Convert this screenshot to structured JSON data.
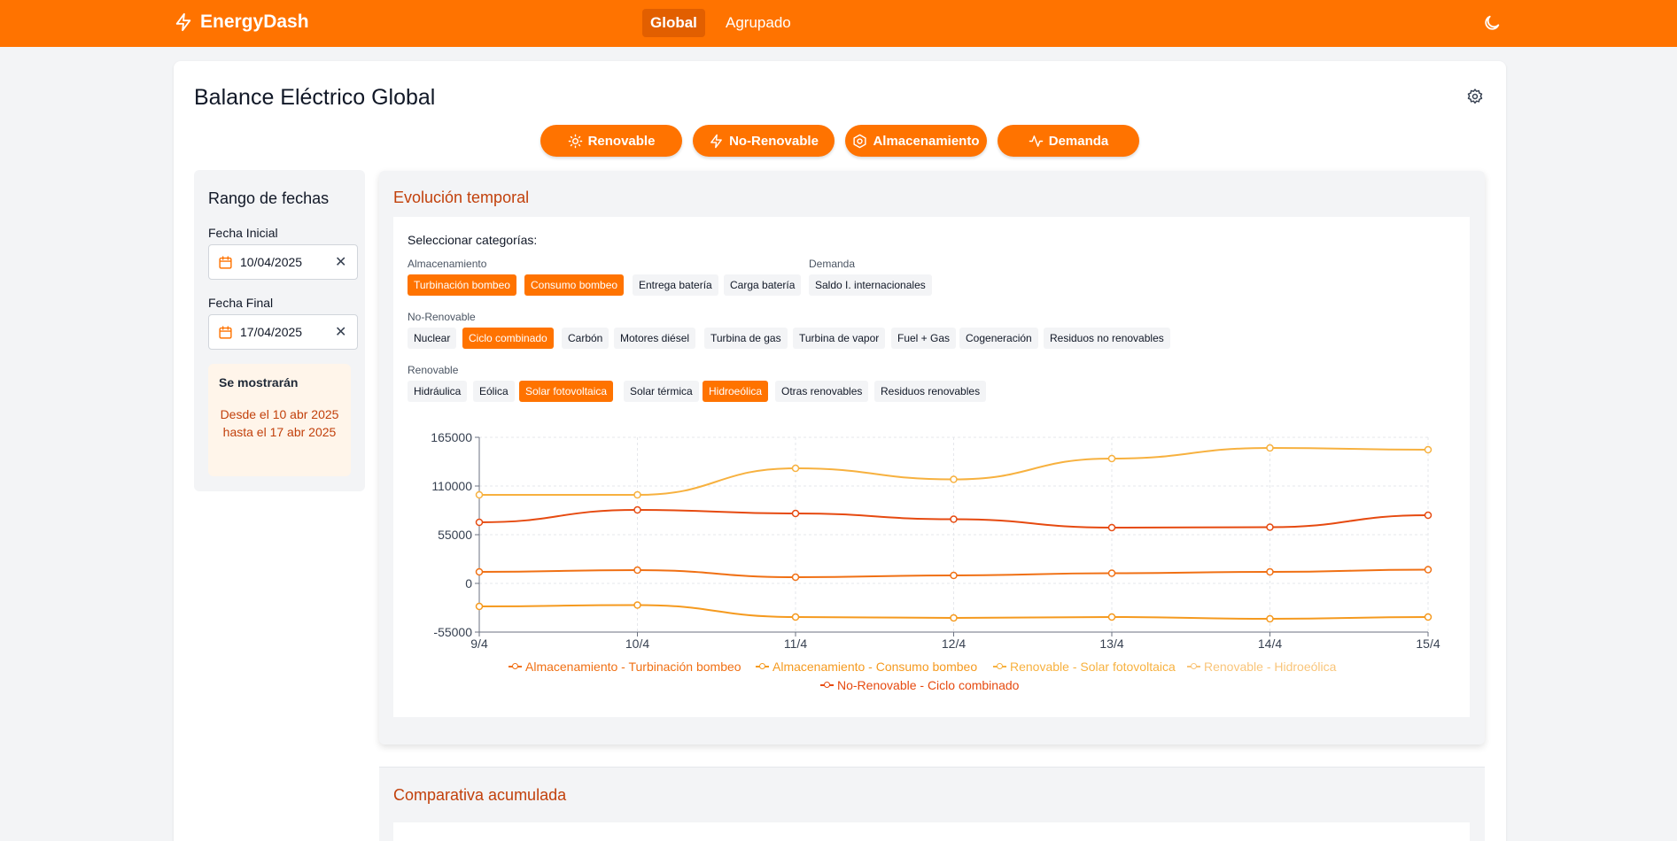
{
  "app": {
    "brand": "EnergyDash",
    "nav": [
      {
        "label": "Global",
        "active": true
      },
      {
        "label": "Agrupado",
        "active": false
      }
    ]
  },
  "page": {
    "title": "Balance Eléctrico Global",
    "categories": [
      {
        "label": "Renovable",
        "icon": "sun-icon"
      },
      {
        "label": "No-Renovable",
        "icon": "lightning-icon"
      },
      {
        "label": "Almacenamiento",
        "icon": "hexagon-icon"
      },
      {
        "label": "Demanda",
        "icon": "activity-icon"
      }
    ]
  },
  "sidebar": {
    "title": "Rango de fechas",
    "start_label": "Fecha Inicial",
    "start_value": "10/04/2025",
    "end_label": "Fecha Final",
    "end_value": "17/04/2025",
    "clear_symbol": "✕",
    "info_title": "Se mostrarán",
    "info_text": "Desde el 10 abr 2025 hasta el 17 abr 2025"
  },
  "panel": {
    "title": "Evolución temporal",
    "select_label": "Seleccionar categorías:",
    "groups": {
      "almacenamiento": {
        "label": "Almacenamiento",
        "chips": [
          {
            "label": "Turbinación bombeo",
            "selected": true
          },
          {
            "label": "Consumo bombeo",
            "selected": true
          },
          {
            "label": "Entrega batería",
            "selected": false
          },
          {
            "label": "Carga batería",
            "selected": false
          }
        ]
      },
      "demanda": {
        "label": "Demanda",
        "chips": [
          {
            "label": "Saldo I. internacionales",
            "selected": false
          }
        ]
      },
      "no_renovable": {
        "label": "No-Renovable",
        "chips": [
          {
            "label": "Nuclear",
            "selected": false
          },
          {
            "label": "Ciclo combinado",
            "selected": true
          },
          {
            "label": "Carbón",
            "selected": false
          },
          {
            "label": "Motores diésel",
            "selected": false
          },
          {
            "label": "Turbina de gas",
            "selected": false
          },
          {
            "label": "Turbina de vapor",
            "selected": false
          },
          {
            "label": "Fuel + Gas",
            "selected": false
          },
          {
            "label": "Cogeneración",
            "selected": false
          },
          {
            "label": "Residuos no renovables",
            "selected": false
          }
        ]
      },
      "renovable": {
        "label": "Renovable",
        "chips": [
          {
            "label": "Hidráulica",
            "selected": false
          },
          {
            "label": "Eólica",
            "selected": false
          },
          {
            "label": "Solar fotovoltaica",
            "selected": true
          },
          {
            "label": "Solar térmica",
            "selected": false
          },
          {
            "label": "Hidroeólica",
            "selected": true
          },
          {
            "label": "Otras renovables",
            "selected": false
          },
          {
            "label": "Residuos renovables",
            "selected": false
          }
        ]
      }
    }
  },
  "panel2": {
    "title": "Comparativa acumulada"
  },
  "colors": {
    "accent": "#ff7300",
    "accent_dark": "#e25f00",
    "title_red": "#c2410c"
  },
  "chart_data": {
    "type": "line",
    "categories": [
      "9/4",
      "10/4",
      "11/4",
      "12/4",
      "13/4",
      "14/4",
      "15/4"
    ],
    "ylim": [
      -55000,
      165000
    ],
    "yticks": [
      "165000",
      "110000",
      "55000",
      "0",
      "-55000"
    ],
    "grid": true,
    "legend_position": "bottom",
    "series": [
      {
        "name": "Almacenamiento - Turbinación bombeo",
        "color": "#f07014",
        "values": [
          13000,
          15000,
          7000,
          9000,
          11500,
          13000,
          15500
        ]
      },
      {
        "name": "Almacenamiento - Consumo bombeo",
        "color": "#f59a1f",
        "values": [
          -26000,
          -24500,
          -38000,
          -39000,
          -38000,
          -40000,
          -38000
        ]
      },
      {
        "name": "Renovable - Solar fotovoltaica",
        "color": "#f7b13f",
        "values": [
          100000,
          100000,
          130000,
          117500,
          141000,
          153000,
          151000
        ]
      },
      {
        "name": "Renovable - Hidroeólica",
        "color": "#f9c57a",
        "values": [
          null,
          null,
          null,
          null,
          null,
          null,
          null
        ]
      },
      {
        "name": "No-Renovable - Ciclo combinado",
        "color": "#e64a10",
        "values": [
          69000,
          83000,
          79000,
          72500,
          63000,
          63500,
          77000
        ]
      }
    ]
  }
}
